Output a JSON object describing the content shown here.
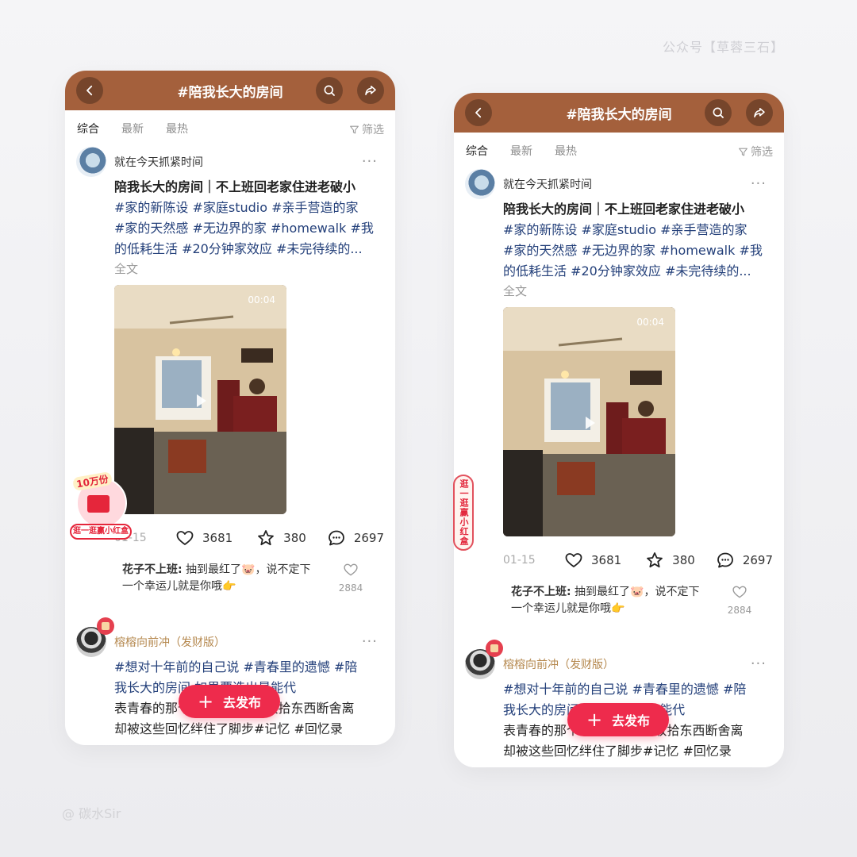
{
  "watermark_top": "公众号【草蓉三石】",
  "watermark_bottom": "@ 碳水Sir",
  "header": {
    "title": "#陪我长大的房间"
  },
  "tabs": [
    "综合",
    "最新",
    "最热"
  ],
  "filter_label": "筛选",
  "post1": {
    "author": "就在今天抓紧时间",
    "title": "陪我长大的房间｜不上班回老家住进老破小",
    "tags_line1": "#家的新陈设  #家庭studio  #亲手营造的家",
    "tags_line2": "#家的天然感  #无边界的家  #homewalk  #我",
    "tags_line3": "的低耗生活  #20分钟家效应  #未完待续的...",
    "fulltext": "全文",
    "duration": "00:04",
    "date": "01-15",
    "likes": "3681",
    "collects": "380",
    "comments": "2697"
  },
  "comment": {
    "user": "花子不上班:",
    "text_line1": " 抽到最红了🐷，说不定下",
    "text_line2": "一个幸运儿就是你哦👉",
    "likes": "2884"
  },
  "post2": {
    "author": "榕榕向前冲（发财版）",
    "line1": "#想对十年前的自己说  #青春里的遗憾  #陪",
    "line2": "我长大的房间  如果要选出最能代",
    "line3": "表青春的那个画面......在家收拾东西断舍离",
    "line4": "却被这些回忆绊住了脚步#记忆  #回忆录"
  },
  "publish_label": "去发布",
  "badge_left": {
    "amount": "10万份",
    "label": "逛一逛赢小红盒"
  },
  "badge_right": {
    "label": "逛一逛赢小红盒"
  },
  "colors": {
    "header": "#a4603c",
    "publish": "#ee2b4c",
    "tag": "#24407a",
    "gold": "#b5884e"
  },
  "icons": [
    "back-icon",
    "search-icon",
    "share-icon",
    "filter-icon",
    "heart-icon",
    "star-icon",
    "comment-icon",
    "play-icon"
  ]
}
